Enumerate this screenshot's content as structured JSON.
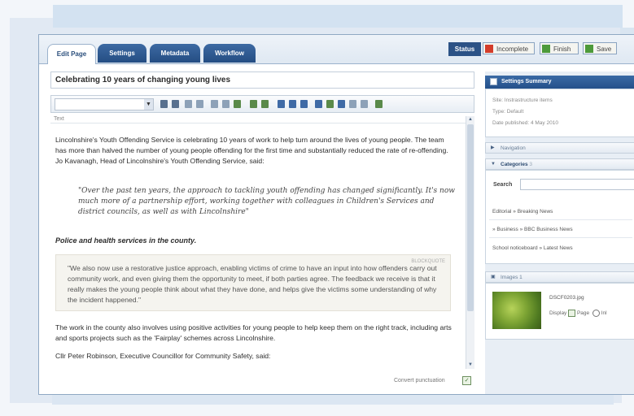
{
  "tabs": [
    {
      "label": "Edit Page",
      "active": true
    },
    {
      "label": "Settings",
      "active": false
    },
    {
      "label": "Metadata",
      "active": false
    },
    {
      "label": "Workflow",
      "active": false
    }
  ],
  "status": {
    "label": "Status",
    "incomplete": "Incomplete",
    "finish": "Finish",
    "save": "Save"
  },
  "editor": {
    "title": "Celebrating 10 years of changing young lives",
    "text_label": "Text",
    "p1": "Lincolnshire's Youth Offending Service is celebrating 10 years of work to help turn around the lives of young people. The team has more than halved the number of young people offending for the first time and substantially reduced the rate of re-offending. Jo Kavanagh, Head of Lincolnshire's Youth Offending Service, said:",
    "quote1": "\"Over the past ten years, the approach to tackling youth offending has changed significantly. It's now much more of a partnership effort, working together with colleagues in Children's Services and district councils, as well as with Lincolnshire\"",
    "heading": "Police and health services in the county.",
    "quote2_tag": "BLOCKQUOTE",
    "quote2": "\"We also now use a restorative justice approach, enabling victims of crime to have an input into how offenders carry out community work, and even giving them the opportunity to meet, if both parties agree. The feedback we receive is that it really makes the young people think about what they have done, and helps give the victims some understanding of why the incident happened.\"",
    "p3": "The work in the county also involves using positive activities for young people to help keep them on the right track, including arts and sports projects such as the 'Fairplay' schemes across Lincolnshire.",
    "p4": "Cllr Peter Robinson, Executive Councillor for Community Safety, said:",
    "convert_label": "Convert punctuation"
  },
  "sidebar": {
    "settings_title": "Settings Summary",
    "site": "Site: Instrastructure items",
    "type": "Type: Default",
    "published": "Date published: 4 May 2010",
    "navigation": "Navigation",
    "categories": "Categories",
    "categories_count": "3",
    "search_label": "Search",
    "category_items": [
      "Editorial » Breaking News",
      "» Business » BBC Business News",
      "School noticeboard » Latest News"
    ],
    "images": "Images",
    "images_count": "1",
    "image_name": "DSCF0203.jpg",
    "display_label": "Display",
    "page_option": "Page",
    "inline_option": "Inl"
  },
  "colors": {
    "accent": "#2c5286",
    "tab": "#244d83",
    "incomplete_icon": "#d33c2a",
    "ok_icon": "#4d9a3a"
  }
}
